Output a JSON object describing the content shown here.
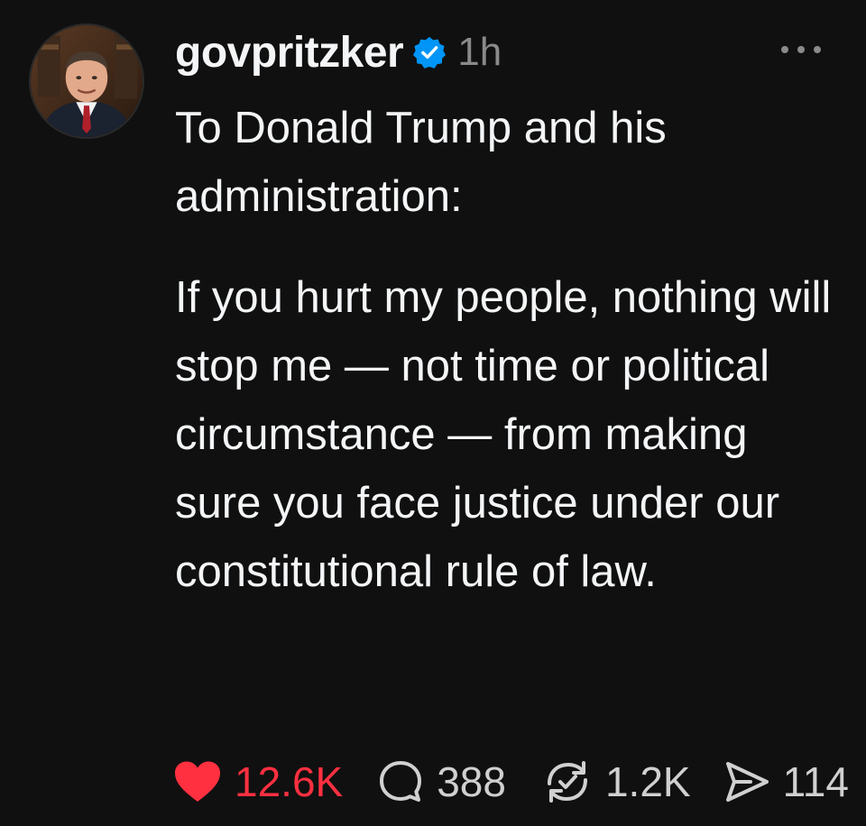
{
  "post": {
    "username": "govpritzker",
    "verified_icon": "verified-badge-icon",
    "timestamp": "1h",
    "paragraphs": [
      "To Donald Trump and his administration:",
      "If you hurt my people, nothing will stop me — not time or political circumstance — from making sure you face justice under our constitutional rule of law."
    ]
  },
  "actions": {
    "like_count": "12.6K",
    "reply_count": "388",
    "repost_count": "1.2K",
    "share_count": "114"
  },
  "colors": {
    "background": "#101010",
    "text": "#f3f5f7",
    "secondary": "#8a8a8a",
    "like": "#ff3040",
    "verified": "#0095f6"
  }
}
